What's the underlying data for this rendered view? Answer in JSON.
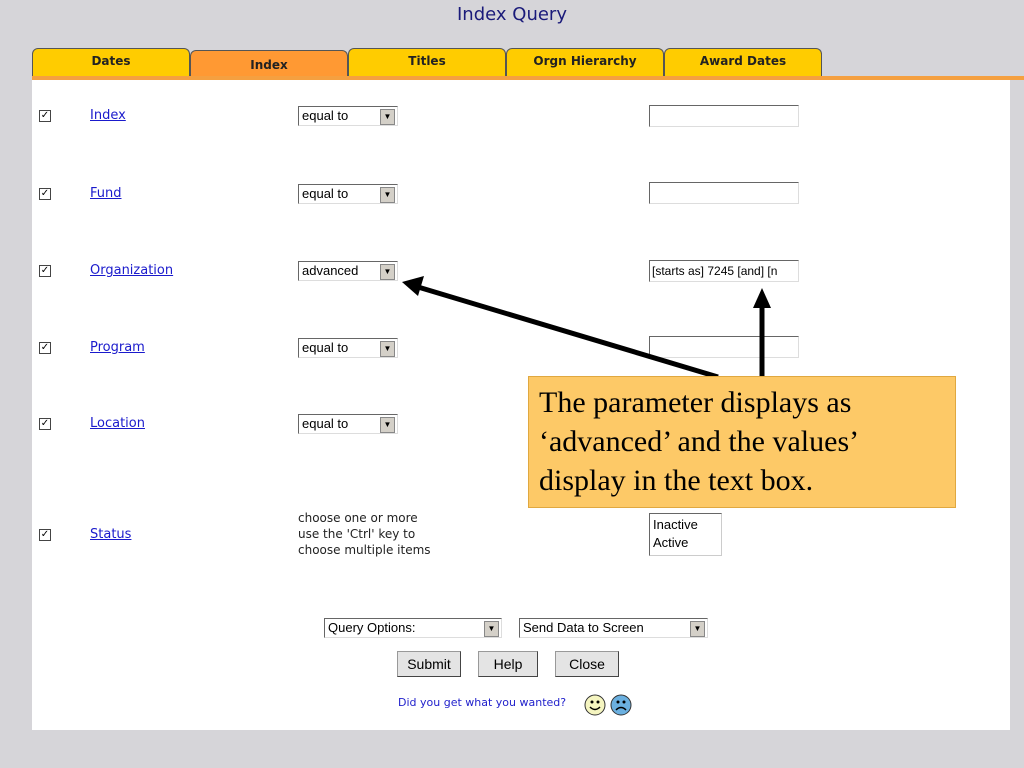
{
  "title": "Index Query",
  "tabs": [
    {
      "label": "Dates"
    },
    {
      "label": "Index"
    },
    {
      "label": "Titles"
    },
    {
      "label": "Orgn Hierarchy"
    },
    {
      "label": "Award Dates"
    }
  ],
  "rows": [
    {
      "check": "✓",
      "label": "Index",
      "operator": "equal to",
      "value": ""
    },
    {
      "check": "✓",
      "label": "Fund",
      "operator": "equal to",
      "value": ""
    },
    {
      "check": "✓",
      "label": "Organization",
      "operator": "advanced",
      "value": "[starts as] 7245 [and] [n"
    },
    {
      "check": "✓",
      "label": "Program",
      "operator": "equal to",
      "value": ""
    },
    {
      "check": "✓",
      "label": "Location",
      "operator": "equal to",
      "value": ""
    }
  ],
  "status": {
    "check": "✓",
    "label": "Status",
    "hint": [
      "choose one or more",
      "use the 'Ctrl' key to",
      "choose multiple items"
    ],
    "options": [
      "Inactive",
      "Active"
    ]
  },
  "footer": {
    "query_options": "Query Options:",
    "output": "Send Data to Screen",
    "submit": "Submit",
    "help": "Help",
    "close": "Close",
    "feedback": "Did you get what you wanted?"
  },
  "callout": "The parameter displays as ‘advanced’ and the values’ display in the text box."
}
